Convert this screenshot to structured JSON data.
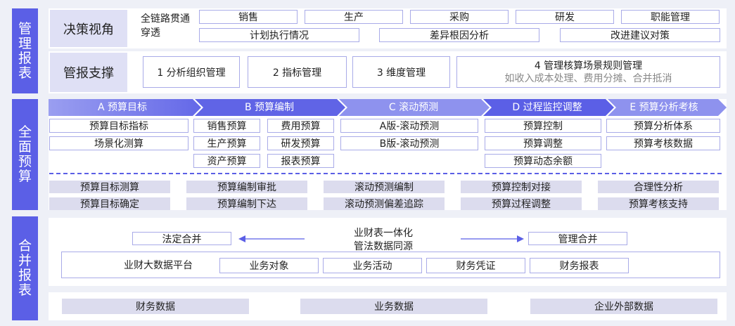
{
  "sections": {
    "mgmt": "管理报表",
    "budget": "全面预算",
    "consol": "合并报表"
  },
  "decision": {
    "title": "决策视角",
    "chain": "全链路贯通穿透",
    "row1": [
      "销售",
      "生产",
      "采购",
      "研发",
      "职能管理"
    ],
    "row2": [
      "计划执行情况",
      "差异根因分析",
      "改进建议对策"
    ]
  },
  "support": {
    "title": "管报支撑",
    "items": [
      "1 分析组织管理",
      "2 指标管理",
      "3 维度管理"
    ],
    "item4_title": "4 管理核算场景规则管理",
    "item4_sub": "如收入成本处理、费用分摊、合并抵消"
  },
  "budget": {
    "stages": [
      "A 预算目标",
      "B 预算编制",
      "C 滚动预测",
      "D 过程监控调整",
      "E 预算分析考核"
    ],
    "a": [
      "预算目标指标",
      "场景化测算"
    ],
    "b_left": [
      "销售预算",
      "生产预算",
      "资产预算"
    ],
    "b_right": [
      "费用预算",
      "研发预算",
      "报表预算"
    ],
    "c": [
      "A版-滚动预测",
      "B版-滚动预测"
    ],
    "d": [
      "预算控制",
      "预算调整",
      "预算动态余额"
    ],
    "e": [
      "预算分析体系",
      "预算考核数据"
    ],
    "support_row1": [
      "预算目标测算",
      "预算编制审批",
      "滚动预测编制",
      "预算控制对接",
      "合理性分析"
    ],
    "support_row2": [
      "预算目标确定",
      "预算编制下达",
      "滚动预测偏差追踪",
      "预算过程调整",
      "预算考核支持"
    ]
  },
  "consol": {
    "legal": "法定合并",
    "center1": "业财表一体化",
    "center2": "管法数据同源",
    "mgmt": "管理合并",
    "platform": "业财大数据平台",
    "items": [
      "业务对象",
      "业务活动",
      "财务凭证",
      "财务报表"
    ]
  },
  "data": [
    "财务数据",
    "业务数据",
    "企业外部数据"
  ],
  "colors": {
    "accent": "#5b5fe6",
    "stage_start": "#8e92ee",
    "stage_end": "#5b5fe6",
    "border": "#a9abe8",
    "soft": "#dfe0f5"
  }
}
